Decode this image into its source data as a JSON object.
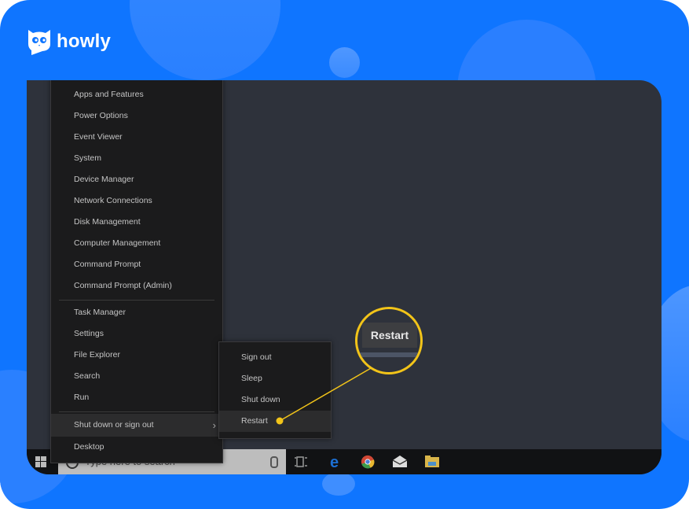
{
  "brand": {
    "name": "howly",
    "accent": "#0f75ff",
    "highlight": "#f2c419"
  },
  "context_menu": {
    "items": [
      {
        "label": "Apps and Features"
      },
      {
        "label": "Power Options"
      },
      {
        "label": "Event Viewer"
      },
      {
        "label": "System"
      },
      {
        "label": "Device Manager"
      },
      {
        "label": "Network Connections"
      },
      {
        "label": "Disk Management"
      },
      {
        "label": "Computer Management"
      },
      {
        "label": "Command Prompt"
      },
      {
        "label": "Command Prompt (Admin)"
      }
    ],
    "items_group2": [
      {
        "label": "Task Manager"
      },
      {
        "label": "Settings"
      },
      {
        "label": "File Explorer"
      },
      {
        "label": "Search"
      },
      {
        "label": "Run"
      }
    ],
    "shutdown": {
      "label": "Shut down or sign out",
      "chevron": "chevron-right-icon"
    },
    "desktop": {
      "label": "Desktop"
    }
  },
  "submenu": {
    "items": [
      {
        "label": "Sign out"
      },
      {
        "label": "Sleep"
      },
      {
        "label": "Shut down"
      },
      {
        "label": "Restart"
      }
    ],
    "active": "Restart"
  },
  "callout": {
    "label": "Restart"
  },
  "taskbar": {
    "start_icon": "windows-logo-icon",
    "search_placeholder": "Type here to search",
    "icons": [
      "microphone-icon",
      "task-view-icon",
      "edge-icon",
      "chrome-icon",
      "mail-icon",
      "file-explorer-icon"
    ]
  }
}
